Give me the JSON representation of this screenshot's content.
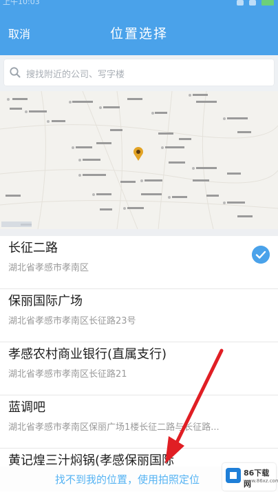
{
  "statusbar": {
    "left_text": "上午10:03"
  },
  "navbar": {
    "cancel_label": "取消",
    "title": "位置选择"
  },
  "search": {
    "placeholder": "搜找附近的公司、写字楼"
  },
  "list": [
    {
      "title": "长征二路",
      "subtitle": "湖北省孝感市孝南区",
      "selected": true
    },
    {
      "title": "保丽国际广场",
      "subtitle": "湖北省孝感市孝南区长征路23号"
    },
    {
      "title": "孝感农村商业银行(直属支行)",
      "subtitle": "湖北省孝感市孝南区长征路21"
    },
    {
      "title": "蓝调吧",
      "subtitle": "湖北省孝感市孝南区保丽广场1楼长征二路与长征路..."
    },
    {
      "title": "黄记煌三汁焖锅(孝感保丽国际",
      "subtitle": ""
    }
  ],
  "banner": {
    "text": "找不到我的位置，使用",
    "link": "拍照定位"
  },
  "watermark": {
    "text": "86下载网",
    "sub": "www.86xz.com"
  },
  "colors": {
    "primary": "#4aa2ea",
    "arrow": "#e01e24",
    "banner_text": "#55b3f3"
  }
}
